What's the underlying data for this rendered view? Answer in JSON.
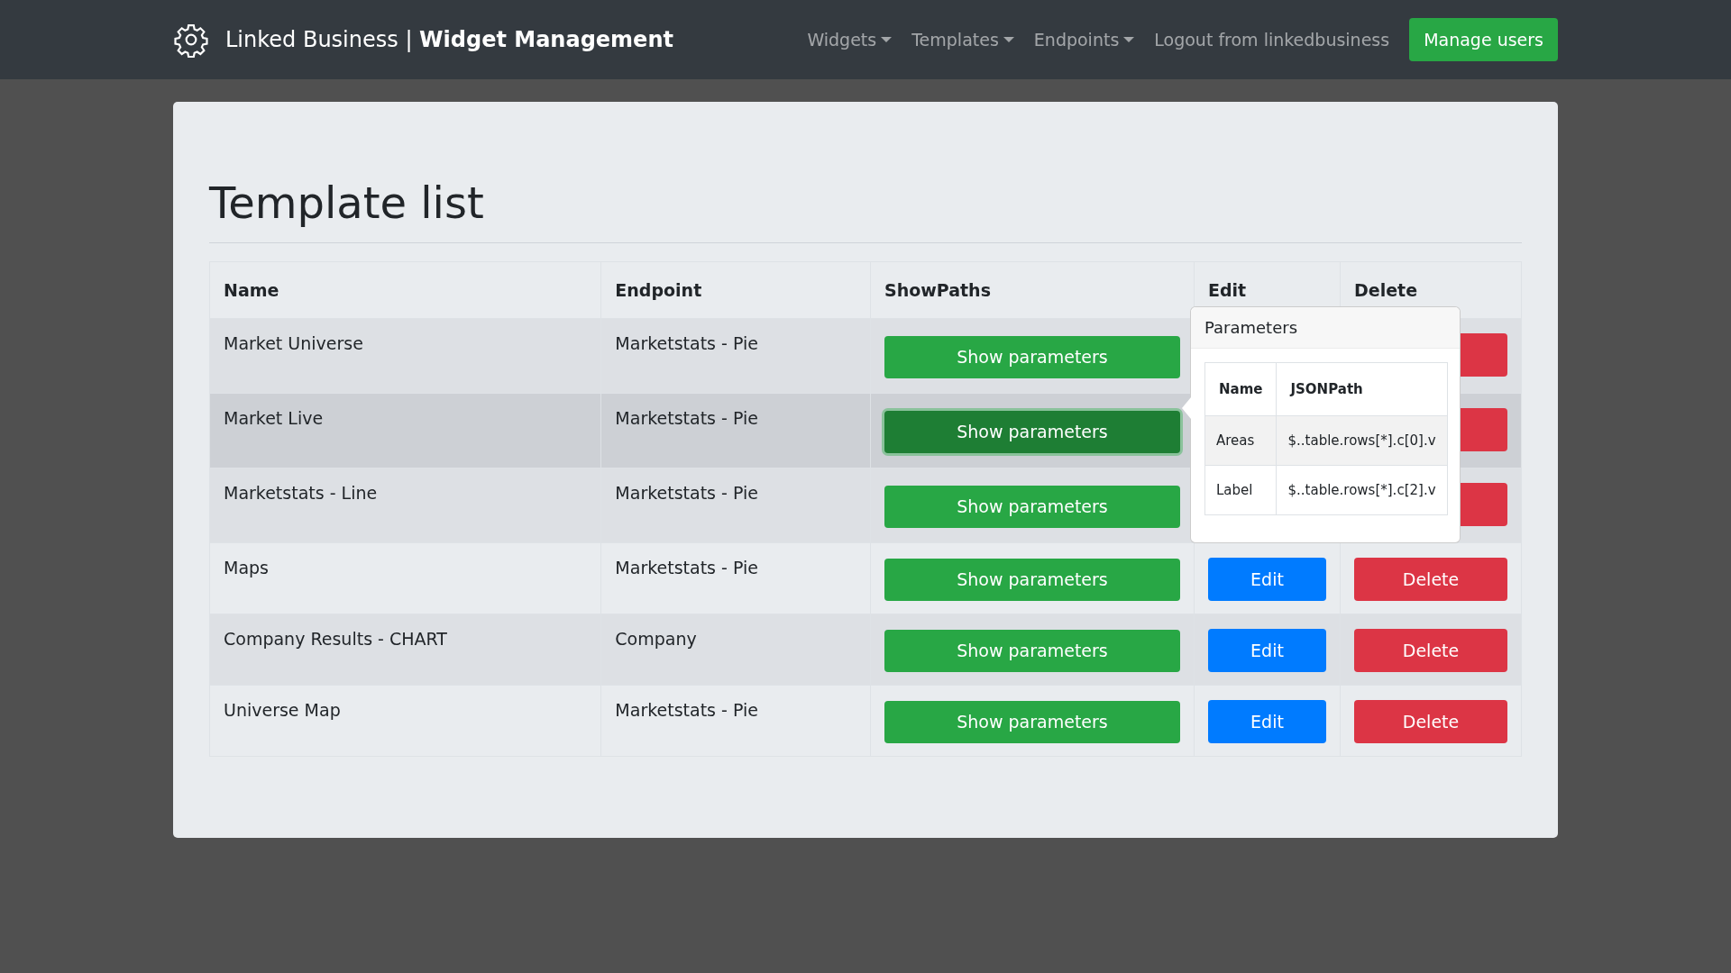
{
  "navbar": {
    "brand": "Linked Business |",
    "brand_strong": "Widget Management",
    "menus": [
      {
        "label": "Widgets",
        "kind": "dropdown"
      },
      {
        "label": "Templates",
        "kind": "dropdown"
      },
      {
        "label": "Endpoints",
        "kind": "dropdown"
      },
      {
        "label": "Logout from linkedbusiness",
        "kind": "link"
      }
    ],
    "action": "Manage users"
  },
  "heading": "Template list",
  "table": {
    "columns": [
      "Name",
      "Endpoint",
      "ShowPaths",
      "Edit",
      "Delete"
    ],
    "rows": [
      {
        "name": "Market Universe",
        "endpoint": "Marketstats - Pie",
        "show": "Show parameters",
        "selected": false,
        "hovered": false
      },
      {
        "name": "Market Live",
        "endpoint": "Marketstats - Pie",
        "show": "Show parameters",
        "selected": true,
        "hovered": true
      },
      {
        "name": "Marketstats - Line",
        "endpoint": "Marketstats - Pie",
        "show": "Show parameters",
        "selected": false,
        "hovered": false
      },
      {
        "name": "Maps",
        "endpoint": "Marketstats - Pie",
        "show": "Show parameters",
        "edit": "Edit",
        "delete": "Delete",
        "selected": false,
        "hovered": false
      },
      {
        "name": "Company Results - CHART",
        "endpoint": "Company",
        "show": "Show parameters",
        "edit": "Edit",
        "delete": "Delete",
        "selected": false,
        "hovered": false
      },
      {
        "name": "Universe Map",
        "endpoint": "Marketstats - Pie",
        "show": "Show parameters",
        "edit": "Edit",
        "delete": "Delete",
        "selected": false,
        "hovered": false
      }
    ]
  },
  "popover": {
    "title": "Parameters",
    "columns": [
      "Name",
      "JSONPath"
    ],
    "rows": [
      {
        "name": "Areas",
        "path": "$..table.rows[*].c[0].v"
      },
      {
        "name": "Label",
        "path": "$..table.rows[*].c[2].v"
      }
    ]
  }
}
